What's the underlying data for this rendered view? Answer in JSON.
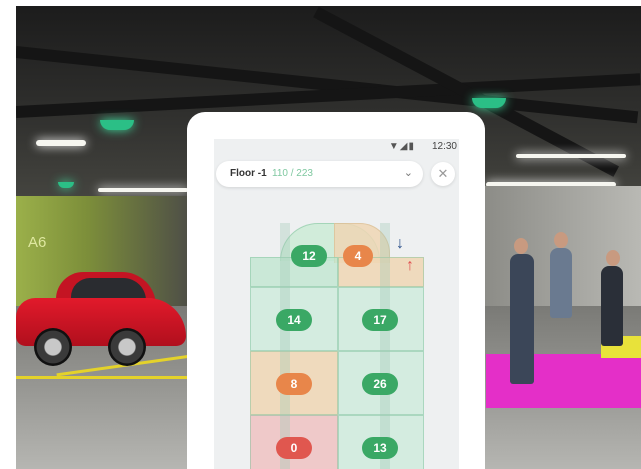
{
  "scene": {
    "pillar_label": "A6",
    "floor_marking": ""
  },
  "phone": {
    "status": {
      "time": "12:30",
      "icons": "▼◢▮"
    },
    "floor_selector": {
      "floor_label": "Floor -1",
      "count": "110 / 223",
      "chevron_icon": "chevron-down-icon"
    },
    "close_icon": "close-icon",
    "map": {
      "directions": {
        "down_arrow": "↓",
        "up_arrow": "↑"
      },
      "spots": [
        {
          "value": "12",
          "status": "green"
        },
        {
          "value": "4",
          "status": "orange"
        },
        {
          "value": "14",
          "status": "green"
        },
        {
          "value": "17",
          "status": "green"
        },
        {
          "value": "8",
          "status": "orange"
        },
        {
          "value": "26",
          "status": "green"
        },
        {
          "value": "0",
          "status": "red"
        },
        {
          "value": "13",
          "status": "green"
        }
      ]
    }
  },
  "colors": {
    "available": "#3aa865",
    "limited": "#e8864a",
    "full": "#e0574f",
    "accent": "#7fc8a0"
  }
}
